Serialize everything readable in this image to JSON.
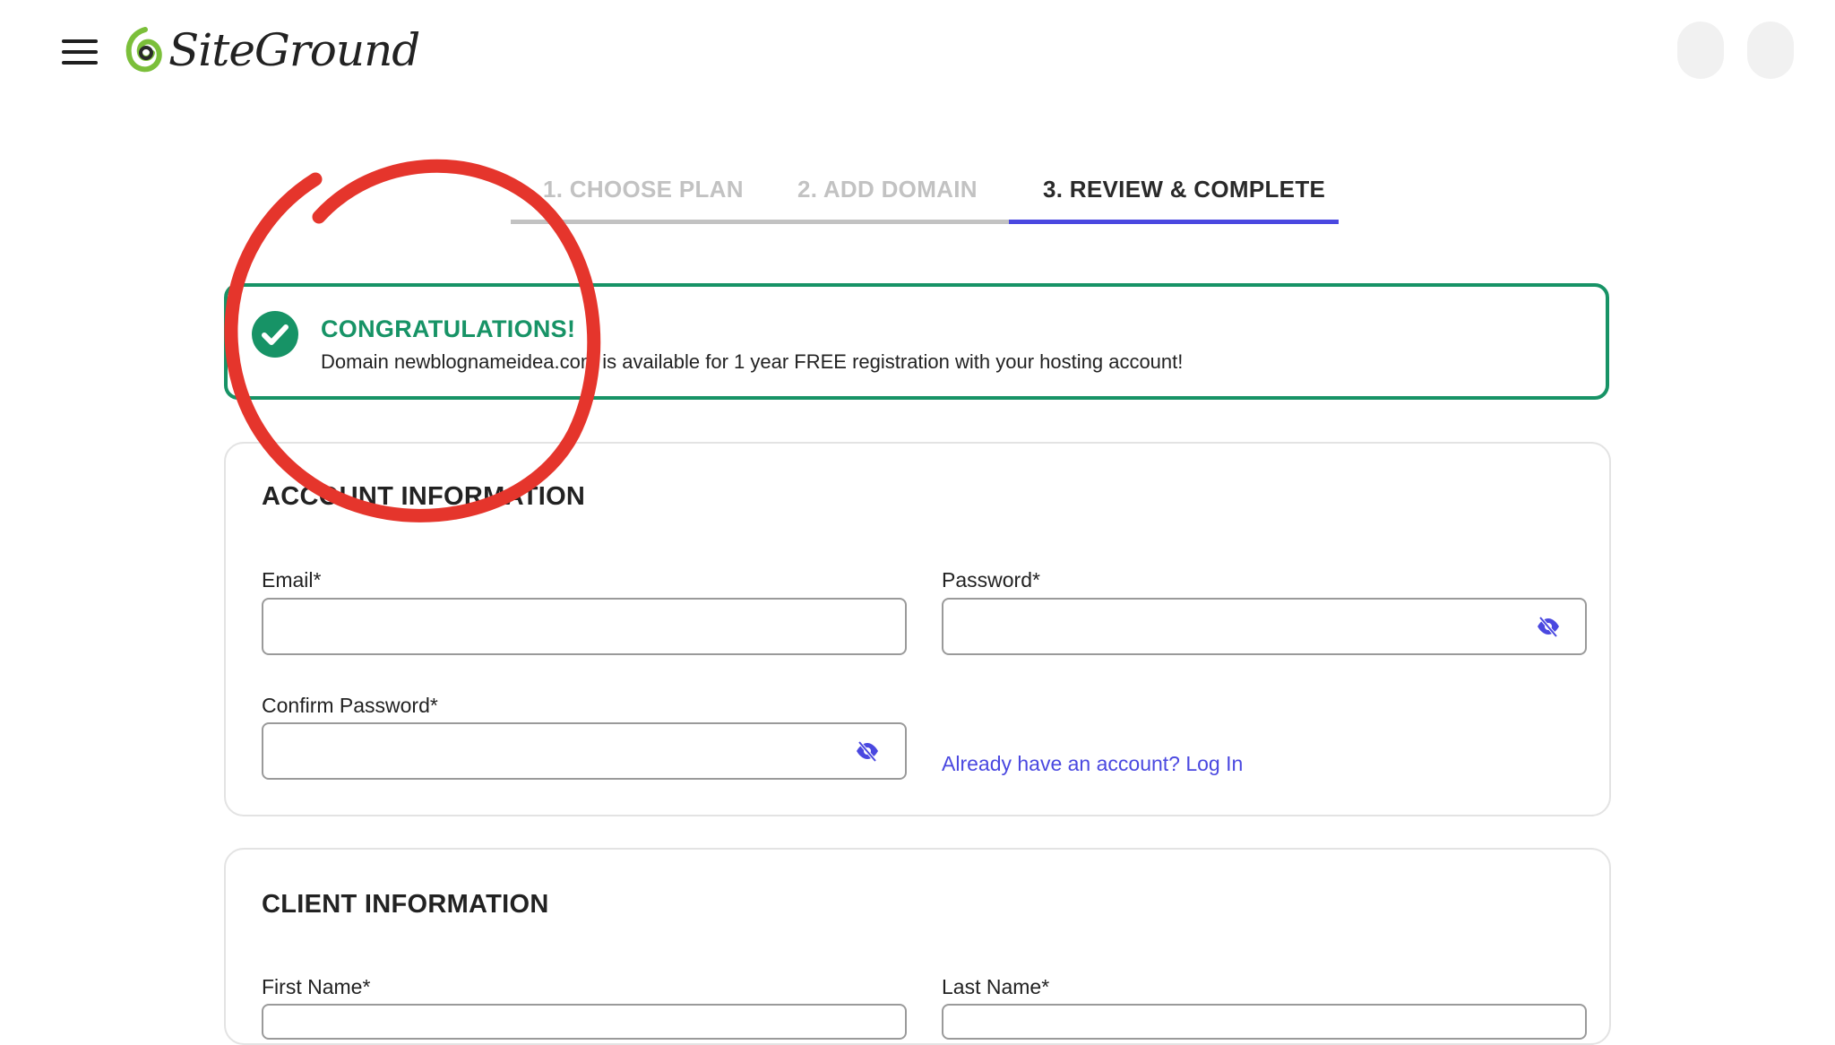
{
  "header": {
    "brand": "SiteGround",
    "menu_icon": "hamburger-menu-icon",
    "logo_icon": "siteground-logo-icon"
  },
  "steps": [
    {
      "label": "1. CHOOSE PLAN",
      "state": "inactive"
    },
    {
      "label": "2. ADD DOMAIN",
      "state": "inactive"
    },
    {
      "label": "3. REVIEW & COMPLETE",
      "state": "active"
    }
  ],
  "banner": {
    "title": "CONGRATULATIONS!",
    "message": "Domain newblognameidea.com is available for 1 year FREE registration with your hosting account!",
    "icon": "check-circle-icon"
  },
  "account": {
    "title": "ACCOUNT INFORMATION",
    "email_label": "Email*",
    "email_value": "",
    "password_label": "Password*",
    "password_value": "",
    "confirm_label": "Confirm Password*",
    "confirm_value": "",
    "login_link": "Already have an account? Log In"
  },
  "client": {
    "title": "CLIENT INFORMATION",
    "first_name_label": "First Name*",
    "last_name_label": "Last Name*"
  },
  "colors": {
    "accent_blue": "#4a48e0",
    "success_green": "#179366",
    "annotation_red": "#e5352c",
    "inactive_step": "#c2c2c2"
  }
}
